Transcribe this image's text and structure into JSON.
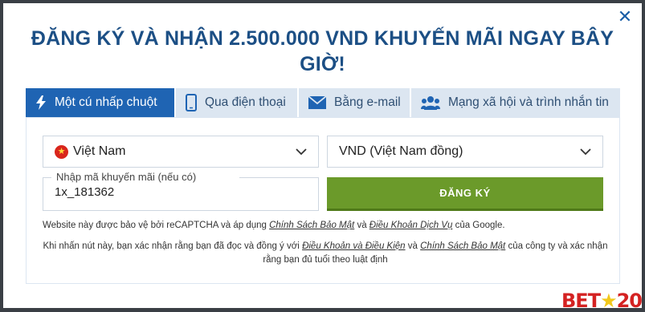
{
  "modal": {
    "title": "ĐĂNG KÝ VÀ NHẬN 2.500.000 VND KHUYẾN MÃI NGAY BÂY GIỜ!",
    "close_icon": "close-icon"
  },
  "tabs": [
    {
      "label": "Một cú nhấp chuột",
      "icon": "lightning-icon",
      "active": true
    },
    {
      "label": "Qua điện thoại",
      "icon": "phone-icon",
      "active": false
    },
    {
      "label": "Bằng e-mail",
      "icon": "envelope-icon",
      "active": false
    },
    {
      "label": "Mạng xã hội và trình nhắn tin",
      "icon": "users-icon",
      "active": false
    }
  ],
  "form": {
    "country": "Việt Nam",
    "currency": "VND (Việt Nam đồng)",
    "promo_label": "Nhập mã khuyến mãi (nếu có)",
    "promo_value": "1x_181362",
    "submit_label": "ĐĂNG KÝ"
  },
  "notes": {
    "recaptcha_prefix": "Website này được bảo vệ bởi reCAPTCHA và áp dụng",
    "privacy_policy": "Chính Sách Bảo Mật",
    "and": "và",
    "terms_of_service": "Điều Khoản Dịch Vụ",
    "recaptcha_suffix": "của Google.",
    "consent_prefix": "Khi nhấn nút này, bạn xác nhận rằng bạn đã đọc và đồng ý với",
    "terms_conditions": "Điều Khoản và Điều Kiện",
    "and2": "và",
    "privacy_policy2": "Chính Sách Bảo Mật",
    "consent_suffix": "của công ty và xác nhận rằng bạn đủ tuổi theo luật định"
  },
  "brand": {
    "part1": "BET",
    "star": "★",
    "part2": "20"
  },
  "colors": {
    "title": "#1c4f85",
    "tab_active": "#1f64b3",
    "tab_bg": "#dce6f1",
    "submit": "#6b9a2a"
  }
}
